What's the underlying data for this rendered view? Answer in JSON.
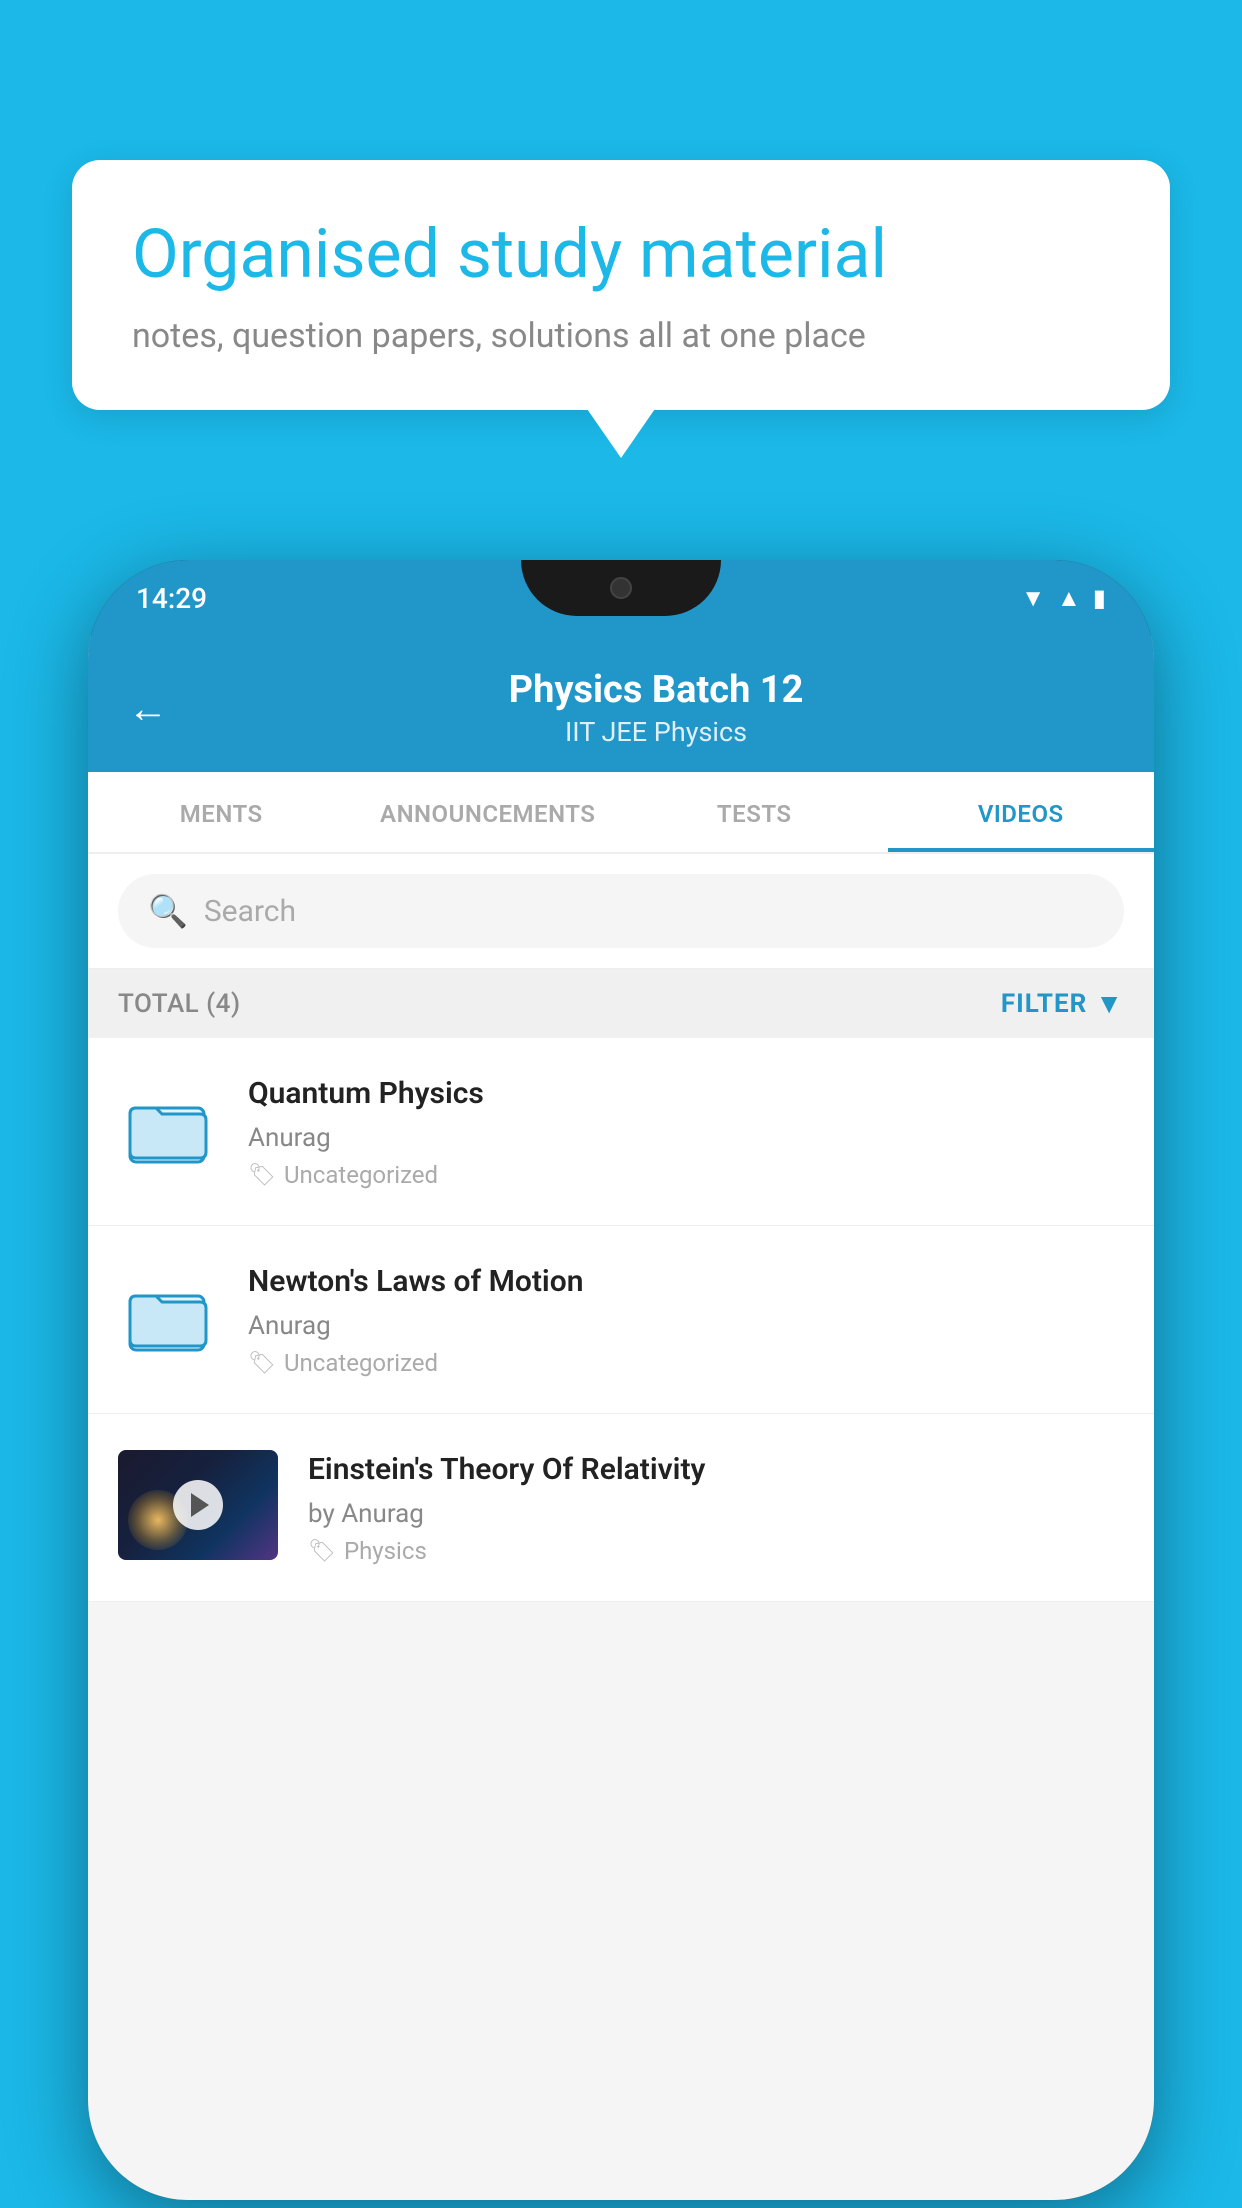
{
  "background_color": "#1bb8e8",
  "bubble": {
    "title": "Organised study material",
    "subtitle": "notes, question papers, solutions all at one place"
  },
  "phone": {
    "status_time": "14:29",
    "header": {
      "title": "Physics Batch 12",
      "subtitle": "IIT JEE   Physics",
      "back_label": "←"
    },
    "tabs": [
      {
        "label": "MENTS",
        "active": false
      },
      {
        "label": "ANNOUNCEMENTS",
        "active": false
      },
      {
        "label": "TESTS",
        "active": false
      },
      {
        "label": "VIDEOS",
        "active": true
      }
    ],
    "search": {
      "placeholder": "Search"
    },
    "filter": {
      "total_label": "TOTAL (4)",
      "button_label": "FILTER"
    },
    "videos": [
      {
        "id": 1,
        "type": "folder",
        "title": "Quantum Physics",
        "author": "Anurag",
        "tag": "Uncategorized"
      },
      {
        "id": 2,
        "type": "folder",
        "title": "Newton's Laws of Motion",
        "author": "Anurag",
        "tag": "Uncategorized"
      },
      {
        "id": 3,
        "type": "video",
        "title": "Einstein's Theory Of Relativity",
        "author": "by Anurag",
        "tag": "Physics"
      }
    ]
  }
}
